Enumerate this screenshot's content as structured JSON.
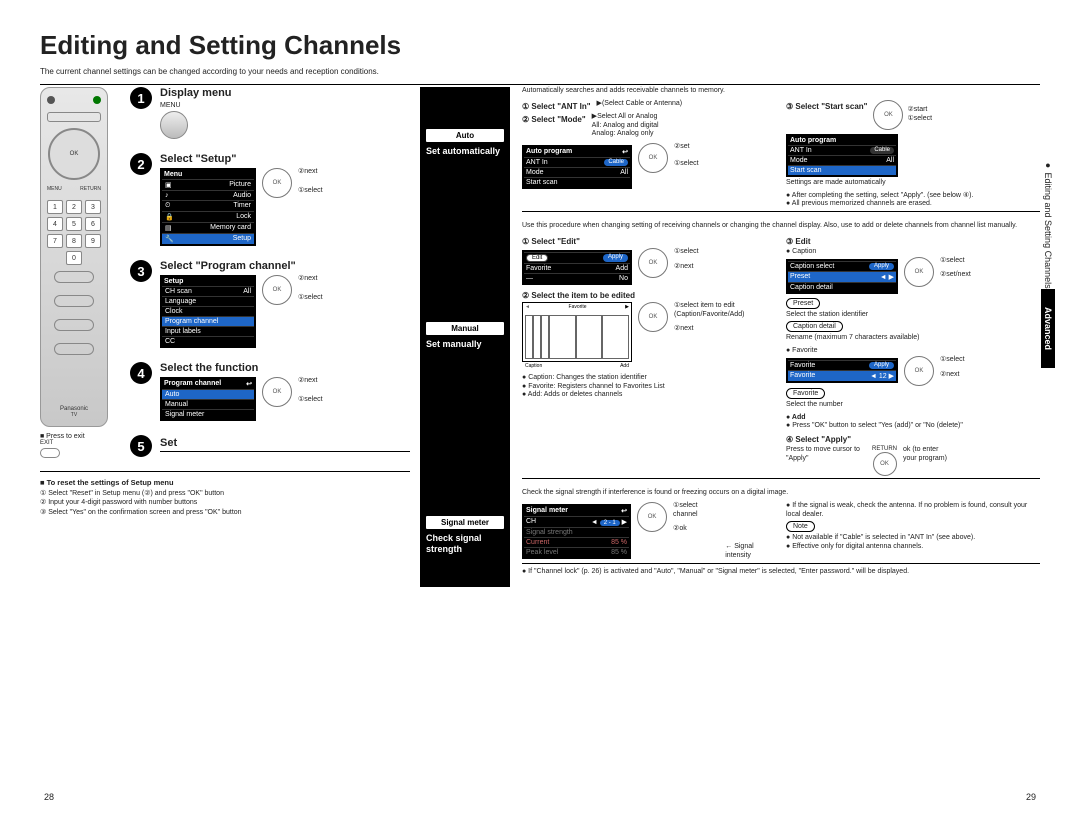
{
  "title": "Editing and Setting Channels",
  "intro": "The current channel settings can be changed according to your needs and reception conditions.",
  "page_left": "28",
  "page_right": "29",
  "side_label": "Editing and Setting Channels",
  "side_adv": "Advanced",
  "remote": {
    "exit_label": "■ Press to exit",
    "exit_btn": "EXIT",
    "brand": "Panasonic",
    "sub": "TV"
  },
  "steps": [
    {
      "num": "1",
      "title": "Display menu",
      "label": "MENU"
    },
    {
      "num": "2",
      "title": "Select \"Setup\"",
      "menu": {
        "hdr": "Menu",
        "items": [
          "Picture",
          "Audio",
          "Timer",
          "Lock",
          "Memory card",
          "Setup"
        ]
      },
      "nav": {
        "a": "②next",
        "b": "①select"
      }
    },
    {
      "num": "3",
      "title": "Select \"Program channel\"",
      "menu": {
        "hdr": "Setup",
        "items": [
          [
            "CH scan",
            "All"
          ],
          [
            "Language",
            ""
          ],
          [
            "Clock",
            ""
          ],
          [
            "Program channel",
            ""
          ],
          [
            "Input labels",
            ""
          ],
          [
            "CC",
            ""
          ]
        ]
      },
      "nav": {
        "a": "②next",
        "b": "①select"
      }
    },
    {
      "num": "4",
      "title": "Select the function",
      "menu": {
        "hdr": "Program channel",
        "items": [
          "Auto",
          "Manual",
          "Signal meter"
        ]
      },
      "nav": {
        "a": "②next",
        "b": "①select"
      }
    },
    {
      "num": "5",
      "title": "Set"
    }
  ],
  "reset": {
    "heading": "■ To reset the settings of Setup menu",
    "lines": [
      "① Select \"Reset\" in Setup menu (②) and press \"OK\" button",
      "② Input your 4-digit password with number buttons",
      "③ Select \"Yes\" on the confirmation screen and press \"OK\" button"
    ]
  },
  "mid": {
    "auto": {
      "btn": "Auto",
      "label": "Set automatically"
    },
    "manual": {
      "btn": "Manual",
      "label": "Set manually"
    },
    "signal": {
      "btn": "Signal meter",
      "label": "Check signal strength"
    }
  },
  "right": {
    "auto": {
      "intro": "Automatically searches and adds receivable channels to memory.",
      "s1": "① Select \"ANT In\"",
      "s1_note": "(Select Cable or Antenna)",
      "s2": "② Select \"Mode\"",
      "s2_note_a": "Select All or Analog",
      "s2_note_b": "All: Analog and digital",
      "s2_note_c": "Analog: Analog only",
      "s3": "③ Select \"Start scan\"",
      "start_ok": "②start",
      "start_sel": "①select",
      "settings": "Settings are made automatically",
      "notes": [
        "After completing the setting, select \"Apply\". (see below ④).",
        "All previous memorized channels are erased."
      ],
      "osd": {
        "hdr": "Auto program",
        "rows": [
          [
            "ANT In",
            "Cable"
          ],
          [
            "Mode",
            "All"
          ],
          [
            "Start scan",
            ""
          ]
        ]
      },
      "osd_nav": {
        "a": "②set",
        "b": "①select"
      }
    },
    "manual": {
      "intro": "Use this procedure when changing setting of receiving channels or changing the channel display. Also, use to add or delete channels from channel list manually.",
      "s1": "① Select \"Edit\"",
      "osd1": {
        "edit": "Edit",
        "apply": "Apply",
        "fav": "Favorite",
        "add": "Add",
        "rows": [
          "—",
          "No"
        ]
      },
      "s1_nav": {
        "a": "①select",
        "b": "②next"
      },
      "s2": "② Select the item to be edited",
      "s2_nav": {
        "a": "①select item to edit (Caption/Favorite/Add)",
        "b": "②next"
      },
      "grid_labels": {
        "fav": "Favorite",
        "cap": "Caption",
        "add": "Add"
      },
      "bullets": [
        "Caption: Changes the station identifier",
        "Favorite: Registers channel to Favorites List",
        "Add: Adds or deletes channels"
      ],
      "s3": "③ Edit",
      "cap_hdr": "● Caption",
      "cap_osd": {
        "hdr": "Caption select",
        "apply": "Apply",
        "preset": "Preset",
        "detail": "Caption detail"
      },
      "cap_nav": {
        "a": "①select",
        "b": "②set/next"
      },
      "preset_btn": "Preset",
      "preset_txt": "Select the station identifier",
      "detail_btn": "Caption detail",
      "detail_txt": "Rename (maximum 7 characters available)",
      "fav_hdr": "● Favorite",
      "fav_osd": {
        "hdr": "Favorite",
        "apply": "Apply",
        "rows": [
          [
            "Favorite",
            "12"
          ]
        ]
      },
      "fav_nav": {
        "a": "①select",
        "b": "②next"
      },
      "fav_btn": "Favorite",
      "fav_txt": "Select the number",
      "add_hdr": "● Add",
      "add_txt": "Press \"OK\" button to select \"Yes (add)\" or \"No (delete)\"",
      "s4": "④ Select \"Apply\"",
      "s4_txt": "Press to move cursor to \"Apply\"",
      "s4_return": "RETURN",
      "s4_ok": "ok (to enter your program)"
    },
    "signal": {
      "intro": "Check the signal strength if interference is found or freezing occurs on a digital image.",
      "osd": {
        "hdr": "Signal meter",
        "rows": [
          [
            "CH",
            "2 - 1"
          ],
          [
            "Signal strength",
            ""
          ],
          [
            "Current",
            "85 %"
          ],
          [
            "Peak level",
            "85 %"
          ]
        ]
      },
      "nav": {
        "a": "①select channel",
        "b": "②ok"
      },
      "arrow": "Signal intensity",
      "bullets": [
        "If the signal is weak, check the antenna. If no problem is found, consult your local dealer."
      ],
      "note_hdr": "Note",
      "notes": [
        "Not available if \"Cable\" is selected in \"ANT In\" (see above).",
        "Effective only for digital antenna channels."
      ]
    },
    "foot": "● If \"Channel lock\" (p. 26) is activated and \"Auto\", \"Manual\" or \"Signal meter\" is selected, \"Enter password.\" will be displayed."
  }
}
